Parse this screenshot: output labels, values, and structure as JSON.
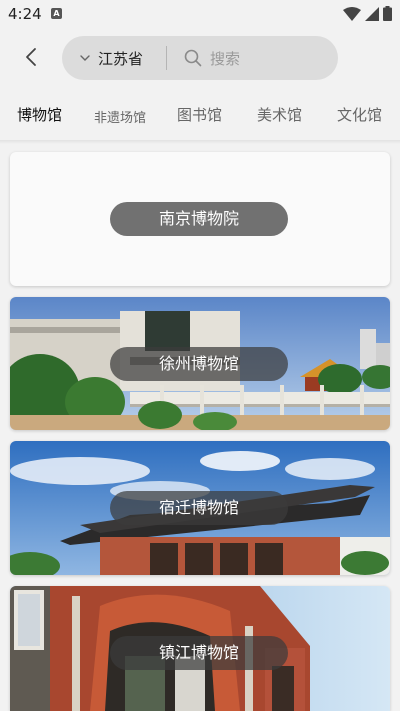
{
  "status": {
    "time": "4:24"
  },
  "header": {
    "province": "江苏省",
    "search_placeholder": "搜索"
  },
  "tabs": [
    "博物馆",
    "非遗场馆",
    "图书馆",
    "美术馆",
    "文化馆"
  ],
  "museums": [
    {
      "name": "南京博物院"
    },
    {
      "name": "徐州博物馆"
    },
    {
      "name": "宿迁博物馆"
    },
    {
      "name": "镇江博物馆"
    }
  ],
  "colors": {
    "background": "#f2f2f2",
    "pill": "#dcdcdc",
    "label_bg": "#3c3c3c"
  }
}
